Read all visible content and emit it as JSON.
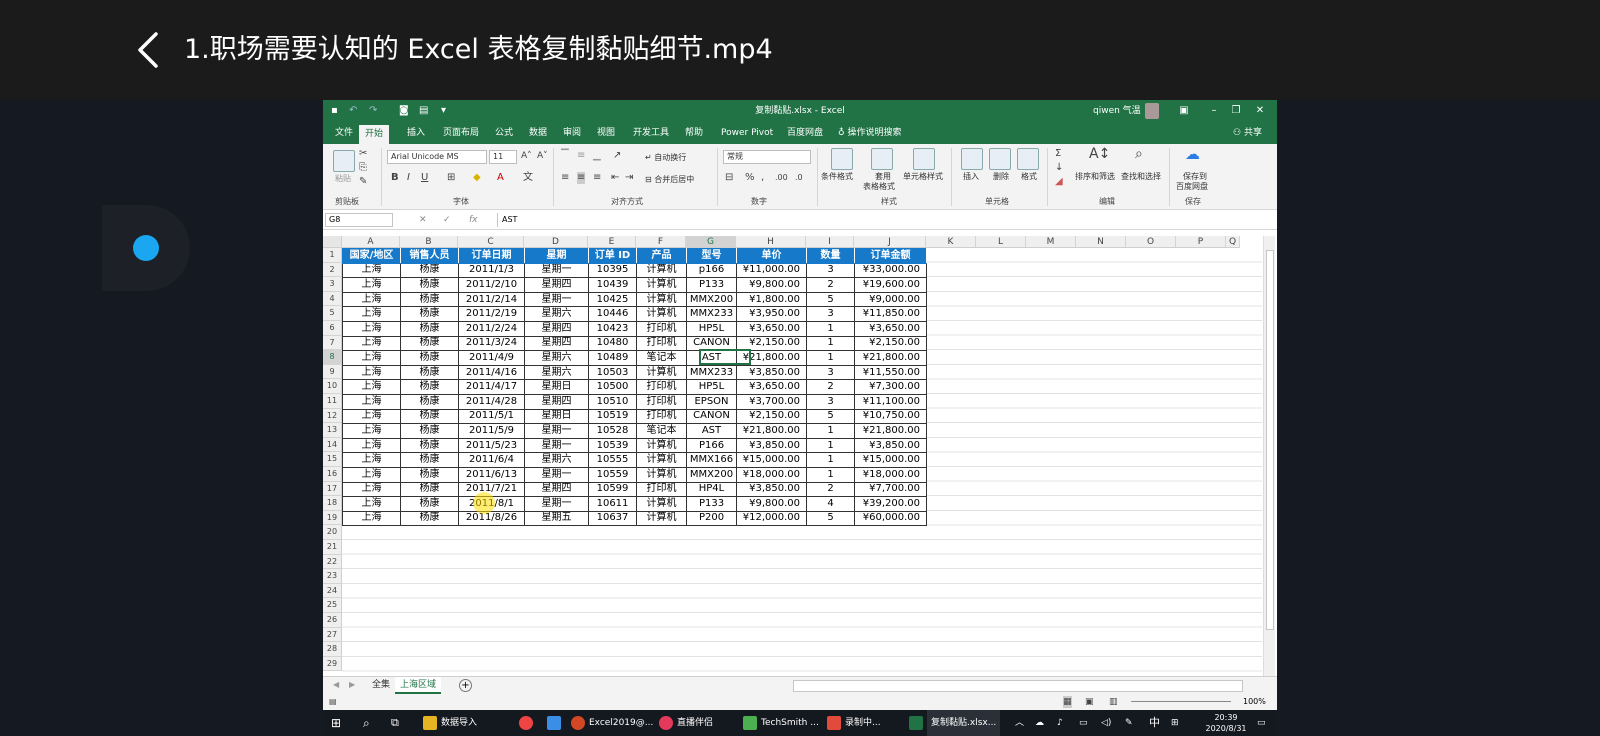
{
  "player": {
    "title": "1.职场需要认知的 Excel 表格复制黏贴细节.mp4"
  },
  "excel": {
    "window_title": "复制黏贴.xlsx - Excel",
    "user": "qiwen 气温",
    "tabs": [
      "文件",
      "开始",
      "插入",
      "页面布局",
      "公式",
      "数据",
      "审阅",
      "视图",
      "开发工具",
      "帮助",
      "Power Pivot",
      "百度网盘"
    ],
    "tell_me": "操作说明搜索",
    "share": "共享",
    "ribbon": {
      "paste": "粘贴",
      "clipboard": "剪贴板",
      "font_name": "Arial Unicode MS",
      "font_size": "11",
      "font_group": "字体",
      "wrap_text": "自动换行",
      "merge_center": "合并后居中",
      "alignment": "对齐方式",
      "number_format": "常规",
      "number": "数字",
      "conditional_format": "条件格式",
      "format_as_table_1": "套用",
      "format_as_table_2": "表格格式",
      "cell_styles": "单元格样式",
      "styles": "样式",
      "insert": "插入",
      "delete": "删除",
      "format": "格式",
      "cells": "单元格",
      "sort_filter": "排序和筛选",
      "find_select": "查找和选择",
      "editing": "编辑",
      "save_to_baidu_1": "保存到",
      "save_to_baidu_2": "百度网盘",
      "save": "保存"
    },
    "name_box": "G8",
    "formula_value": "AST",
    "columns": [
      "A",
      "B",
      "C",
      "D",
      "E",
      "F",
      "G",
      "H",
      "I",
      "J",
      "K",
      "L",
      "M",
      "N",
      "O",
      "P",
      "Q"
    ],
    "rows": [
      "1",
      "2",
      "3",
      "4",
      "5",
      "6",
      "7",
      "8",
      "9",
      "10",
      "11",
      "12",
      "13",
      "14",
      "15",
      "16",
      "17",
      "18",
      "19",
      "20",
      "21",
      "22",
      "23",
      "24",
      "25",
      "26",
      "27",
      "28",
      "29"
    ],
    "table_header": [
      "国家/地区",
      "销售人员",
      "订单日期",
      "星期",
      "订单 ID",
      "产品",
      "型号",
      "单价",
      "数量",
      "订单金额"
    ],
    "table_rows": [
      [
        "上海",
        "杨康",
        "2011/1/3",
        "星期一",
        "10395",
        "计算机",
        "p166",
        "¥11,000.00",
        "3",
        "¥33,000.00"
      ],
      [
        "上海",
        "杨康",
        "2011/2/10",
        "星期四",
        "10439",
        "计算机",
        "P133",
        "¥9,800.00",
        "2",
        "¥19,600.00"
      ],
      [
        "上海",
        "杨康",
        "2011/2/14",
        "星期一",
        "10425",
        "计算机",
        "MMX200",
        "¥1,800.00",
        "5",
        "¥9,000.00"
      ],
      [
        "上海",
        "杨康",
        "2011/2/19",
        "星期六",
        "10446",
        "计算机",
        "MMX233",
        "¥3,950.00",
        "3",
        "¥11,850.00"
      ],
      [
        "上海",
        "杨康",
        "2011/2/24",
        "星期四",
        "10423",
        "打印机",
        "HP5L",
        "¥3,650.00",
        "1",
        "¥3,650.00"
      ],
      [
        "上海",
        "杨康",
        "2011/3/24",
        "星期四",
        "10480",
        "打印机",
        "CANON",
        "¥2,150.00",
        "1",
        "¥2,150.00"
      ],
      [
        "上海",
        "杨康",
        "2011/4/9",
        "星期六",
        "10489",
        "笔记本",
        "AST",
        "¥21,800.00",
        "1",
        "¥21,800.00"
      ],
      [
        "上海",
        "杨康",
        "2011/4/16",
        "星期六",
        "10503",
        "计算机",
        "MMX233",
        "¥3,850.00",
        "3",
        "¥11,550.00"
      ],
      [
        "上海",
        "杨康",
        "2011/4/17",
        "星期日",
        "10500",
        "打印机",
        "HP5L",
        "¥3,650.00",
        "2",
        "¥7,300.00"
      ],
      [
        "上海",
        "杨康",
        "2011/4/28",
        "星期四",
        "10510",
        "打印机",
        "EPSON",
        "¥3,700.00",
        "3",
        "¥11,100.00"
      ],
      [
        "上海",
        "杨康",
        "2011/5/1",
        "星期日",
        "10519",
        "打印机",
        "CANON",
        "¥2,150.00",
        "5",
        "¥10,750.00"
      ],
      [
        "上海",
        "杨康",
        "2011/5/9",
        "星期一",
        "10528",
        "笔记本",
        "AST",
        "¥21,800.00",
        "1",
        "¥21,800.00"
      ],
      [
        "上海",
        "杨康",
        "2011/5/23",
        "星期一",
        "10539",
        "计算机",
        "P166",
        "¥3,850.00",
        "1",
        "¥3,850.00"
      ],
      [
        "上海",
        "杨康",
        "2011/6/4",
        "星期六",
        "10555",
        "计算机",
        "MMX166",
        "¥15,000.00",
        "1",
        "¥15,000.00"
      ],
      [
        "上海",
        "杨康",
        "2011/6/13",
        "星期一",
        "10559",
        "计算机",
        "MMX200",
        "¥18,000.00",
        "1",
        "¥18,000.00"
      ],
      [
        "上海",
        "杨康",
        "2011/7/21",
        "星期四",
        "10599",
        "打印机",
        "HP4L",
        "¥3,850.00",
        "2",
        "¥7,700.00"
      ],
      [
        "上海",
        "杨康",
        "2011/8/1",
        "星期一",
        "10611",
        "计算机",
        "P133",
        "¥9,800.00",
        "4",
        "¥39,200.00"
      ],
      [
        "上海",
        "杨康",
        "2011/8/26",
        "星期五",
        "10637",
        "计算机",
        "P200",
        "¥12,000.00",
        "5",
        "¥60,000.00"
      ]
    ],
    "sheet_tabs": [
      "全集",
      "上海区域"
    ],
    "active_sheet": "上海区域",
    "zoom": "100%"
  },
  "taskbar": {
    "items": [
      "数据导入",
      "Excel2019@...",
      "直播伴侣",
      "TechSmith ...",
      "录制中...",
      "复制黏贴.xlsx..."
    ],
    "ime": "中",
    "time": "20:39",
    "date": "2020/8/31"
  },
  "colors": {
    "excel_green": "#217346",
    "header_blue": "#1779c9",
    "dot_blue": "#1aa6f0"
  }
}
